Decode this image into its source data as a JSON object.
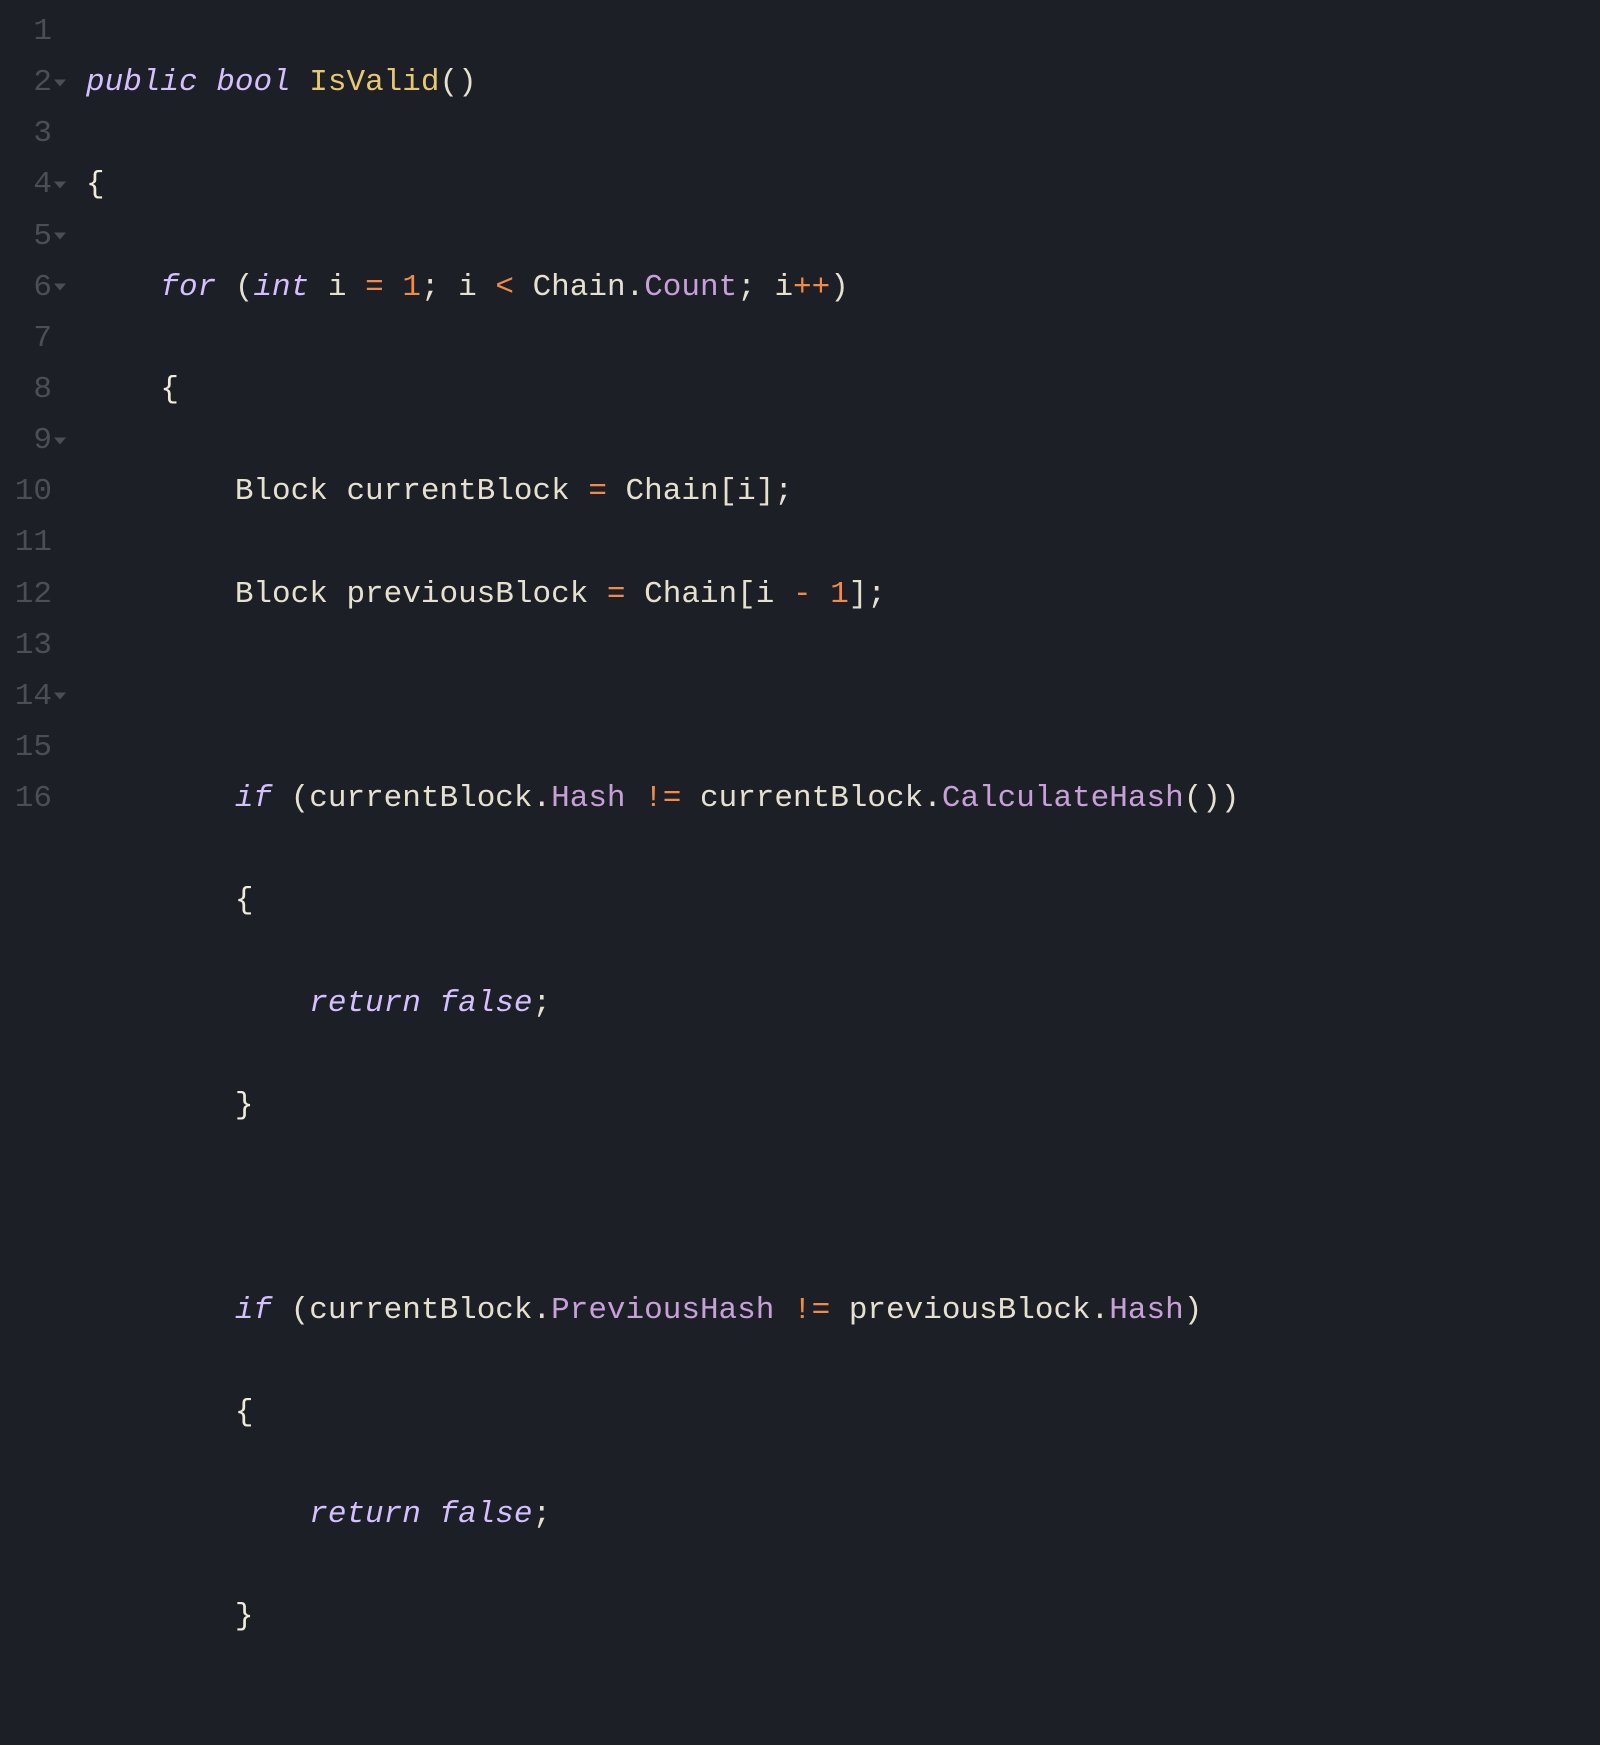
{
  "gutter": {
    "lines": [
      {
        "num": "1",
        "fold": false
      },
      {
        "num": "2",
        "fold": true
      },
      {
        "num": "3",
        "fold": false
      },
      {
        "num": "4",
        "fold": true
      },
      {
        "num": "5",
        "fold": true
      },
      {
        "num": "6",
        "fold": true
      },
      {
        "num": "7",
        "fold": false
      },
      {
        "num": "8",
        "fold": false
      },
      {
        "num": "9",
        "fold": true
      },
      {
        "num": "10",
        "fold": false
      },
      {
        "num": "11",
        "fold": false
      },
      {
        "num": "12",
        "fold": false
      },
      {
        "num": "13",
        "fold": false
      },
      {
        "num": "14",
        "fold": true
      },
      {
        "num": "15",
        "fold": false
      },
      {
        "num": "16",
        "fold": false
      }
    ]
  },
  "tokens": {
    "public": "public",
    "bool": "bool",
    "IsValid": "IsValid",
    "for": "for",
    "int": "int",
    "i": "i",
    "one": "1",
    "lt": "<",
    "eq": "=",
    "neq": "!=",
    "plusplus": "++",
    "minus": "-",
    "Chain": "Chain",
    "Count": "Count",
    "Block": "Block",
    "currentBlock": "currentBlock",
    "previousBlock": "previousBlock",
    "if": "if",
    "Hash": "Hash",
    "CalculateHash": "CalculateHash",
    "PreviousHash": "PreviousHash",
    "return": "return",
    "false": "false",
    "lbrace": "{",
    "rbrace": "}",
    "lparen": "(",
    "rparen": ")",
    "lbracket": "[",
    "rbracket": "]",
    "semi": ";",
    "dot": "."
  }
}
